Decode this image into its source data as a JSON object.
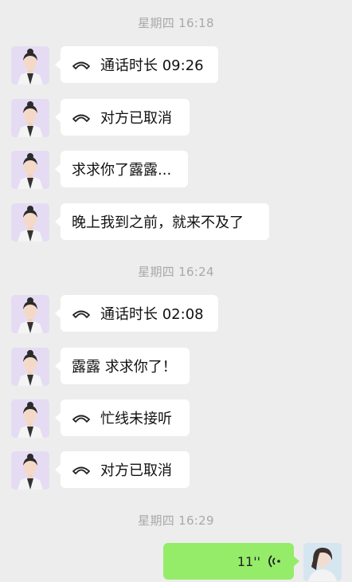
{
  "timestamps": [
    "星期四 16:18",
    "星期四 16:24",
    "星期四 16:29"
  ],
  "messages": [
    {
      "text": "通话时长 09:26",
      "call": true
    },
    {
      "text": "对方已取消",
      "call": true
    },
    {
      "text": "求求你了露露...",
      "call": false
    },
    {
      "text": "晚上我到之前，就来不及了",
      "call": false
    },
    {
      "text": "通话时长 02:08",
      "call": true
    },
    {
      "text": "露露 求求你了！",
      "call": false
    },
    {
      "text": "忙线未接听",
      "call": true
    },
    {
      "text": "对方已取消",
      "call": true
    }
  ],
  "voice_message": {
    "duration": "11''"
  },
  "colors": {
    "background": "#ededed",
    "bubble_incoming": "#ffffff",
    "bubble_outgoing": "#95ec69",
    "timestamp": "#a9a9a9"
  },
  "icons": {
    "call": "phone-handset-icon",
    "voice": "voice-wave-icon"
  }
}
